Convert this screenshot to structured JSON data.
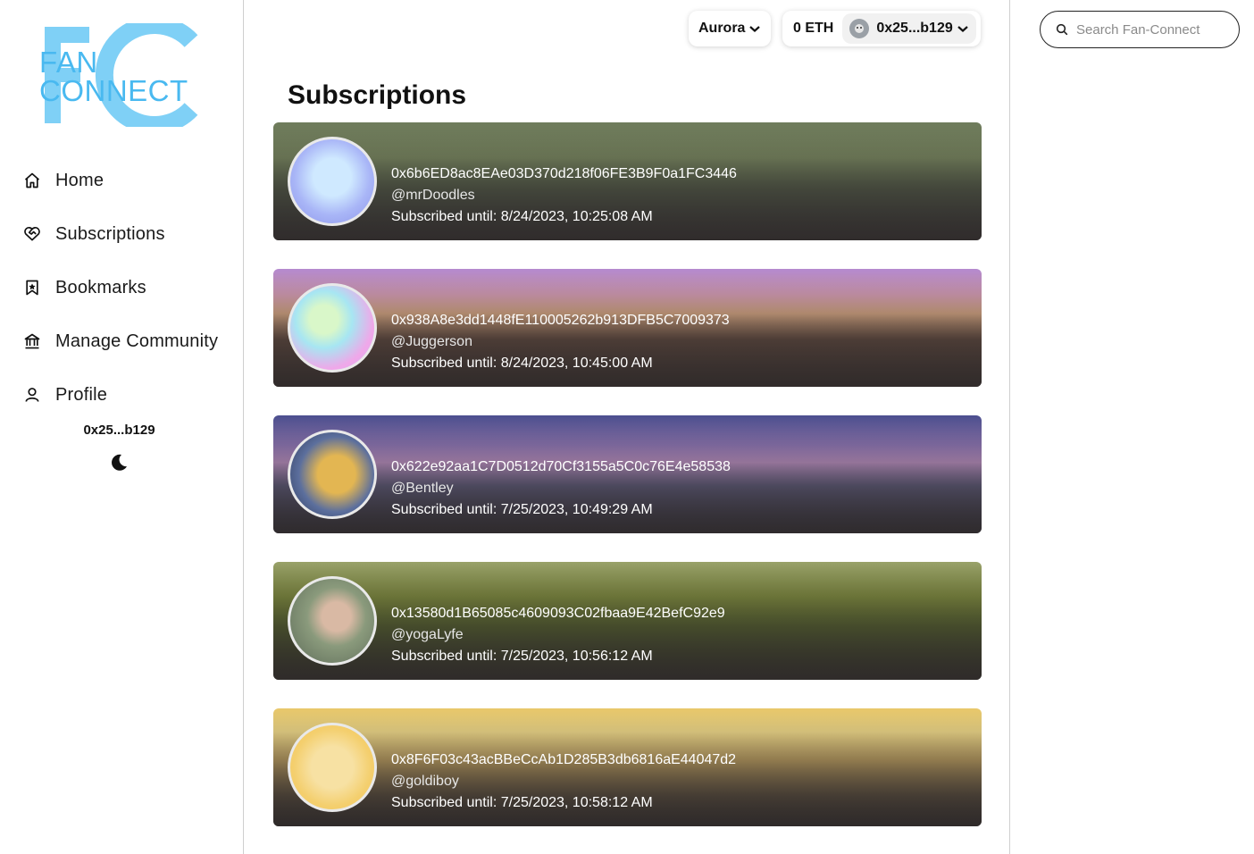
{
  "brand": {
    "line1": "FAN",
    "line2": "CONNECT",
    "color": "#49b9f0"
  },
  "sidebar": {
    "items": [
      {
        "label": "Home",
        "icon": "home-icon"
      },
      {
        "label": "Subscriptions",
        "icon": "heart-handshake-icon"
      },
      {
        "label": "Bookmarks",
        "icon": "bookmark-star-icon"
      },
      {
        "label": "Manage Community",
        "icon": "bank-icon"
      },
      {
        "label": "Profile",
        "icon": "user-icon"
      }
    ],
    "address": "0x25...b129",
    "theme_toggle_icon": "moon-icon"
  },
  "header": {
    "network": "Aurora",
    "balance": "0 ETH",
    "account": "0x25...b129"
  },
  "main": {
    "title": "Subscriptions",
    "subscriptions": [
      {
        "address": "0x6b6ED8ac8EAe03D370d218f06FE3B9F0a1FC3446",
        "handle": "@mrDoodles",
        "until": "Subscribed until: 8/24/2023, 10:25:08 AM"
      },
      {
        "address": "0x938A8e3dd1448fE110005262b913DFB5C7009373",
        "handle": "@Juggerson",
        "until": "Subscribed until: 8/24/2023, 10:45:00 AM"
      },
      {
        "address": "0x622e92aa1C7D0512d70Cf3155a5C0c76E4e58538",
        "handle": "@Bentley",
        "until": "Subscribed until: 7/25/2023, 10:49:29 AM"
      },
      {
        "address": "0x13580d1B65085c4609093C02fbaa9E42BefC92e9",
        "handle": "@yogaLyfe",
        "until": "Subscribed until: 7/25/2023, 10:56:12 AM"
      },
      {
        "address": "0x8F6F03c43acBBeCcAb1D285B3db6816aE44047d2",
        "handle": "@goldiboy",
        "until": "Subscribed until: 7/25/2023, 10:58:12 AM"
      }
    ]
  },
  "search": {
    "placeholder": "Search Fan-Connect",
    "value": ""
  }
}
